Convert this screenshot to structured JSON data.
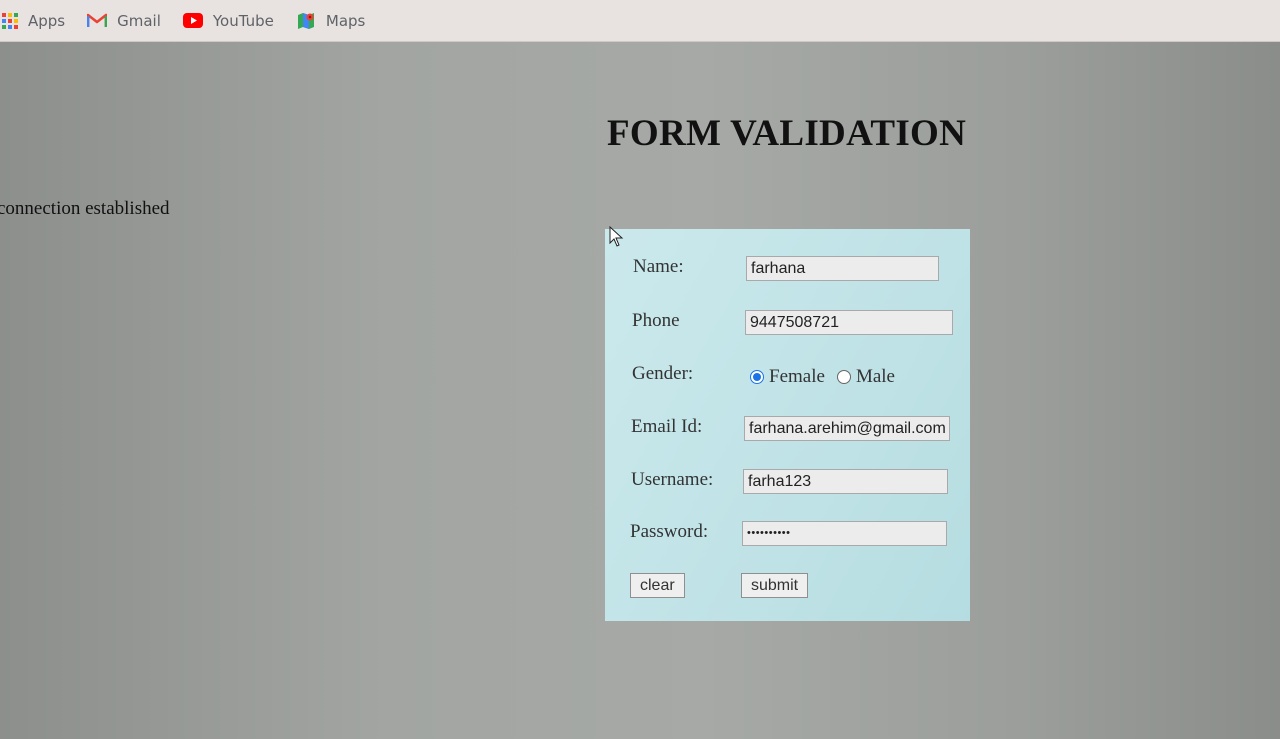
{
  "bookmarks": [
    {
      "label": "Apps",
      "icon": "apps-grid-icon"
    },
    {
      "label": "Gmail",
      "icon": "gmail-icon"
    },
    {
      "label": "YouTube",
      "icon": "youtube-icon"
    },
    {
      "label": "Maps",
      "icon": "maps-icon"
    }
  ],
  "page": {
    "title": "FORM VALIDATION",
    "status": "connection established"
  },
  "form": {
    "name_label": "Name:",
    "name_value": "farhana",
    "phone_label": "Phone",
    "phone_value": "9447508721",
    "gender_label": "Gender:",
    "gender_options": [
      "Female",
      "Male"
    ],
    "gender_selected": "Female",
    "email_label": "Email Id:",
    "email_value": "farhana.arehim@gmail.com",
    "username_label": "Username:",
    "username_value": "farha123",
    "password_label": "Password:",
    "password_value": "••••••••••",
    "clear_label": "clear",
    "submit_label": "submit"
  },
  "colors": {
    "form_background": "#bfe2e6",
    "radio_accent": "#1a73e8"
  }
}
